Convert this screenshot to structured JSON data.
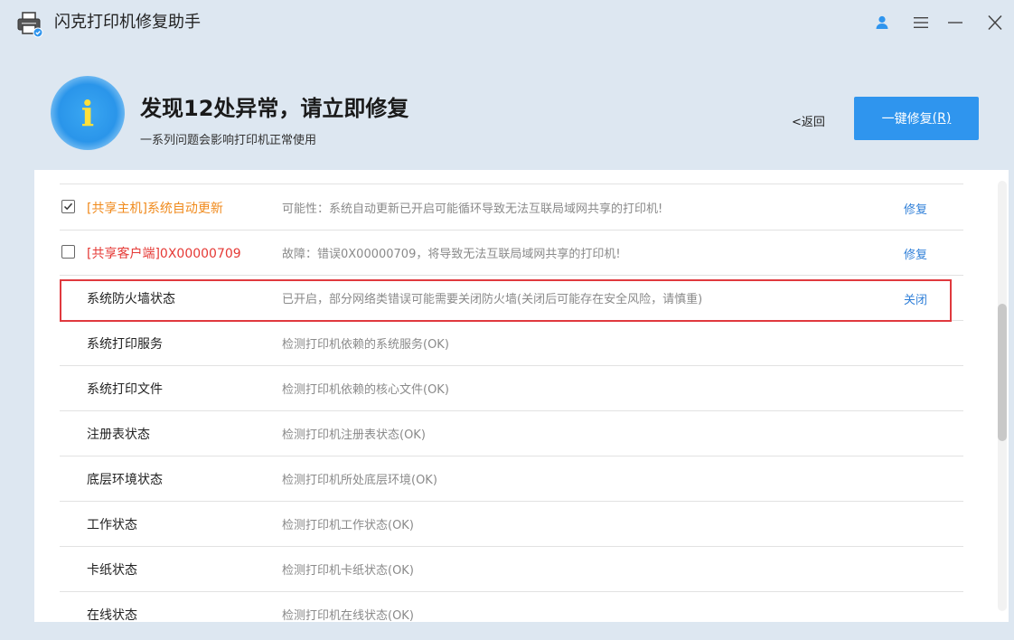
{
  "titlebar": {
    "title": "闪克打印机修复助手",
    "icons": [
      "printer-app-icon",
      "user-icon",
      "menu-icon",
      "minimize-icon",
      "close-icon"
    ]
  },
  "header": {
    "headline": "发现12处异常，请立即修复",
    "subline": "一系列问题会影响打印机正常使用",
    "back_label": "<返回",
    "fix_button": {
      "label": "一键修复",
      "shortcut": "(R)"
    }
  },
  "list": {
    "rows": [
      {
        "name": "[共享主机]系统自动更新",
        "name_color": "orange",
        "description": "可能性：系统自动更新已开启可能循环导致无法互联局域网共享的打印机!",
        "action": "修复",
        "checkbox": true,
        "checked": true
      },
      {
        "name": "[共享客户端]0X00000709",
        "name_color": "red",
        "description": "故障：错误0X00000709，将导致无法互联局域网共享的打印机!",
        "action": "修复",
        "checkbox": true,
        "checked": false
      },
      {
        "name": "系统防火墙状态",
        "name_color": "normal",
        "description": "已开启，部分网络类错误可能需要关闭防火墙(关闭后可能存在安全风险，请慎重)",
        "action": "关闭",
        "checkbox": false,
        "checked": false
      },
      {
        "name": "系统打印服务",
        "name_color": "normal",
        "description": "检测打印机依赖的系统服务(OK)",
        "action": "",
        "checkbox": false,
        "checked": false
      },
      {
        "name": "系统打印文件",
        "name_color": "normal",
        "description": "检测打印机依赖的核心文件(OK)",
        "action": "",
        "checkbox": false,
        "checked": false
      },
      {
        "name": "注册表状态",
        "name_color": "normal",
        "description": "检测打印机注册表状态(OK)",
        "action": "",
        "checkbox": false,
        "checked": false
      },
      {
        "name": "底层环境状态",
        "name_color": "normal",
        "description": "检测打印机所处底层环境(OK)",
        "action": "",
        "checkbox": false,
        "checked": false
      },
      {
        "name": "工作状态",
        "name_color": "normal",
        "description": "检测打印机工作状态(OK)",
        "action": "",
        "checkbox": false,
        "checked": false
      },
      {
        "name": "卡纸状态",
        "name_color": "normal",
        "description": "检测打印机卡纸状态(OK)",
        "action": "",
        "checkbox": false,
        "checked": false
      },
      {
        "name": "在线状态",
        "name_color": "normal",
        "description": "检测打印机在线状态(OK)",
        "action": "",
        "checkbox": false,
        "checked": false
      }
    ]
  },
  "colors": {
    "accent": "#2f95ee",
    "link": "#2f7fd8",
    "warning_orange": "#f08a1c",
    "error_red": "#e53935",
    "highlight_border": "#e0393e"
  }
}
